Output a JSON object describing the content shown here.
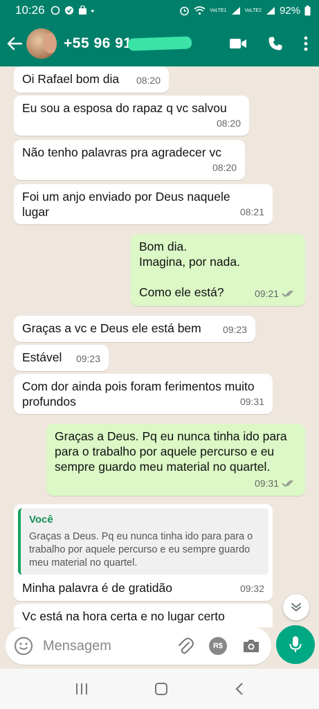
{
  "status": {
    "time": "10:26",
    "battery": "92%",
    "sim1": "VoLTE1",
    "sim2": "VoLTE2"
  },
  "header": {
    "contact": "+55 96 91"
  },
  "messages": [
    {
      "dir": "in",
      "text": "Oi Rafael bom dia",
      "time": "08:20"
    },
    {
      "dir": "in",
      "text": "Eu sou a esposa do rapaz q vc salvou",
      "time": "08:20"
    },
    {
      "dir": "in",
      "text": "Não tenho palavras pra agradecer vc",
      "time": "08:20"
    },
    {
      "dir": "in",
      "text": "Foi um anjo enviado por Deus naquele lugar",
      "time": "08:21"
    },
    {
      "dir": "out",
      "text": "Bom dia.\nImagina, por nada.\n\nComo ele está?",
      "time": "09:21"
    },
    {
      "dir": "in",
      "text": "Graças a vc e Deus ele está bem",
      "time": "09:23"
    },
    {
      "dir": "in",
      "text": "Estável",
      "time": "09:23"
    },
    {
      "dir": "in",
      "text": "Com dor ainda pois foram ferimentos muito profundos",
      "time": "09:31"
    },
    {
      "dir": "out",
      "text": "Graças a Deus. Pq eu nunca  tinha ido para para o trabalho por aquele percurso e eu sempre guardo meu material no quartel.",
      "time": "09:31"
    },
    {
      "dir": "in",
      "quote_author": "Você",
      "quote_text": "Graças a Deus. Pq eu nunca  tinha ido para para o trabalho por aquele percurso e eu sempre guardo meu material no quartel.",
      "text": "Minha palavra é de gratidão",
      "time": "09:32"
    },
    {
      "dir": "in",
      "text": "Vc está na hora certa e no lugar certo",
      "time": ""
    }
  ],
  "composer": {
    "placeholder": "Mensagem",
    "currency_label": "R$"
  },
  "colors": {
    "header": "#00806b",
    "outgoing": "#dbf8c6",
    "incoming": "#ffffff",
    "accent": "#00a884"
  }
}
